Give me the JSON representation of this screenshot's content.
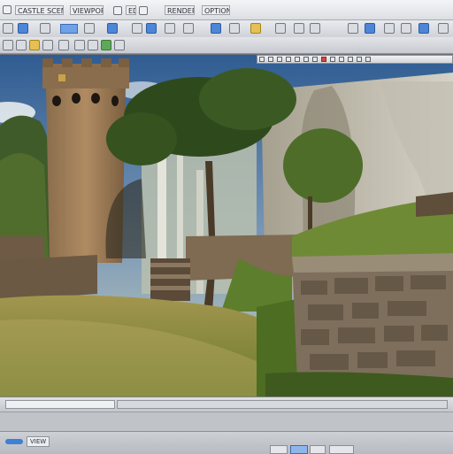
{
  "menubar": {
    "items": [
      {
        "label": "CASTLE SCENE",
        "name": "menu-file"
      },
      {
        "label": "VIEWPORT",
        "name": "menu-view"
      },
      {
        "label": "EDIT",
        "name": "menu-edit"
      },
      {
        "label": "RENDERER",
        "name": "menu-render"
      },
      {
        "label": "OPTIONS",
        "name": "menu-options"
      }
    ]
  },
  "statusbar": {
    "label": "VIEW"
  },
  "colors": {
    "chrome": "#c9cbd0",
    "accent": "#4d86d8",
    "sky": "#3d6ea8",
    "grass": "#6d8a34",
    "stone": "#8b7860"
  }
}
